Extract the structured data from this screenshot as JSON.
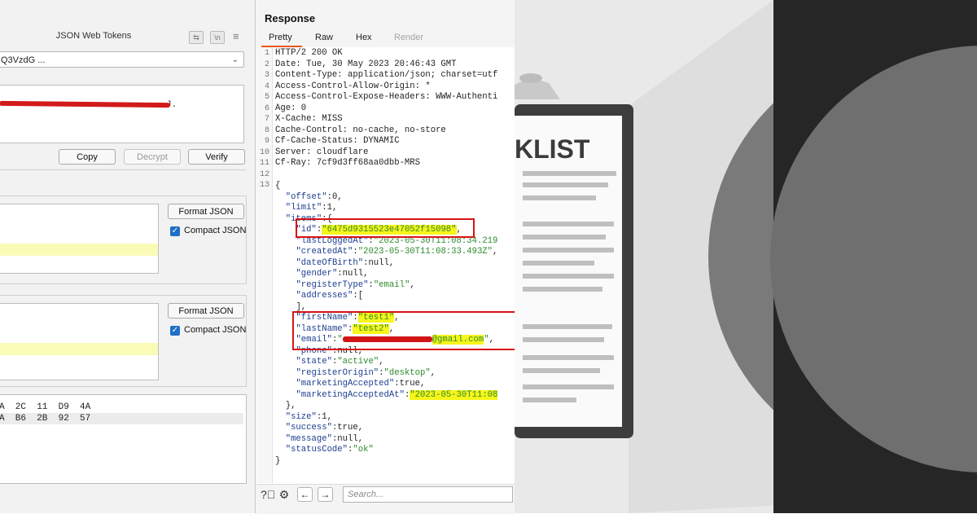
{
  "jwt_panel": {
    "title": "JSON Web Tokens",
    "token_select_value": "Q3VzdG ...",
    "token_text": "J.",
    "buttons": {
      "copy": "Copy",
      "decrypt": "Decrypt",
      "verify": "Verify"
    },
    "header_section": {
      "format_label": "Format JSON",
      "compact_label": "Compact JSON",
      "compact_checked": true
    },
    "payload_section": {
      "format_label": "Format JSON",
      "compact_label": "Compact JSON",
      "compact_checked": true
    },
    "hex_rows": [
      "A  2C  11  D9  4A",
      "A  B6  2B  92  57"
    ]
  },
  "response": {
    "title": "Response",
    "tabs": [
      "Pretty",
      "Raw",
      "Hex",
      "Render"
    ],
    "headers": [
      "HTTP/2 200 OK",
      "Date: Tue, 30 May 2023 20:46:43 GMT",
      "Content-Type: application/json; charset=utf",
      "Access-Control-Allow-Origin: *",
      "Access-Control-Expose-Headers: WWW-Authenti",
      "Age: 0",
      "X-Cache: MISS",
      "Cache-Control: no-cache, no-store",
      "Cf-Cache-Status: DYNAMIC",
      "Server: cloudflare",
      "Cf-Ray: 7cf9d3ff68aa0dbb-MRS"
    ],
    "body": {
      "open": "{",
      "offset": "0",
      "limit": "1",
      "items_key": "items",
      "id": "6475d9315523e47052f15098",
      "lastLoggedAt": "2023-05-30T11:08:34.219",
      "createdAt": "2023-05-30T11:08:33.493Z",
      "dateOfBirth": "null",
      "gender": "null",
      "registerType": "email",
      "addresses_close": "],",
      "firstName": "test1",
      "lastName": "test2",
      "email_suffix": "@gmail.com",
      "phone": "null",
      "state": "active",
      "registerOrigin": "desktop",
      "marketingAccepted": "true",
      "marketingAcceptedAt": "2023-05-30T11:08",
      "items_close": "},",
      "size": "1",
      "success": "true",
      "message": "null",
      "statusCode": "ok",
      "close": "}"
    },
    "search_placeholder": "Search..."
  },
  "illustration": {
    "heading": "KLIST"
  },
  "colors": {
    "highlight": "#f7f51a",
    "annotation_red": "#d81414",
    "json_key": "#1c3d8f",
    "json_string": "#2d8a2d",
    "tab_accent": "#e8581e",
    "checkbox": "#1f6fc4"
  }
}
